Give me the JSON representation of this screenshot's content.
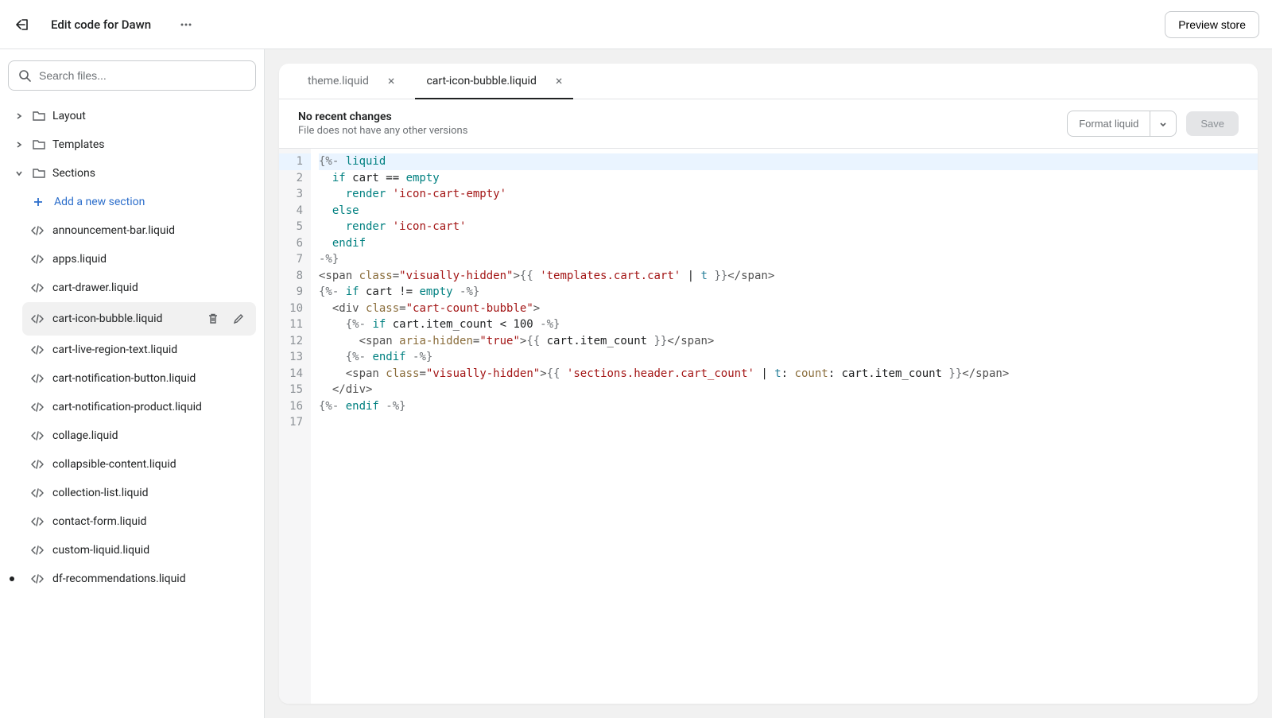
{
  "header": {
    "title": "Edit code for Dawn",
    "preview_label": "Preview store"
  },
  "sidebar": {
    "search_placeholder": "Search files...",
    "folders": [
      {
        "name": "Layout",
        "expanded": false
      },
      {
        "name": "Templates",
        "expanded": false
      },
      {
        "name": "Sections",
        "expanded": true
      }
    ],
    "add_section_label": "Add a new section",
    "files": [
      {
        "name": "announcement-bar.liquid",
        "active": false,
        "dot": false
      },
      {
        "name": "apps.liquid",
        "active": false,
        "dot": false
      },
      {
        "name": "cart-drawer.liquid",
        "active": false,
        "dot": false
      },
      {
        "name": "cart-icon-bubble.liquid",
        "active": true,
        "dot": false
      },
      {
        "name": "cart-live-region-text.liquid",
        "active": false,
        "dot": false
      },
      {
        "name": "cart-notification-button.liquid",
        "active": false,
        "dot": false
      },
      {
        "name": "cart-notification-product.liquid",
        "active": false,
        "dot": false
      },
      {
        "name": "collage.liquid",
        "active": false,
        "dot": false
      },
      {
        "name": "collapsible-content.liquid",
        "active": false,
        "dot": false
      },
      {
        "name": "collection-list.liquid",
        "active": false,
        "dot": false
      },
      {
        "name": "contact-form.liquid",
        "active": false,
        "dot": false
      },
      {
        "name": "custom-liquid.liquid",
        "active": false,
        "dot": false
      },
      {
        "name": "df-recommendations.liquid",
        "active": false,
        "dot": true
      }
    ]
  },
  "tabs": [
    {
      "label": "theme.liquid",
      "active": false
    },
    {
      "label": "cart-icon-bubble.liquid",
      "active": true
    }
  ],
  "toolbar": {
    "title": "No recent changes",
    "subtitle": "File does not have any other versions",
    "format_label": "Format liquid",
    "save_label": "Save"
  },
  "editor": {
    "line_count": 17,
    "highlighted_line": 1,
    "raw_lines": [
      "{%- liquid",
      "  if cart == empty",
      "    render 'icon-cart-empty'",
      "  else",
      "    render 'icon-cart'",
      "  endif",
      "-%}",
      "<span class=\"visually-hidden\">{{ 'templates.cart.cart' | t }}</span>",
      "{%- if cart != empty -%}",
      "  <div class=\"cart-count-bubble\">",
      "    {%- if cart.item_count < 100 -%}",
      "      <span aria-hidden=\"true\">{{ cart.item_count }}</span>",
      "    {%- endif -%}",
      "    <span class=\"visually-hidden\">{{ 'sections.header.cart_count' | t: count: cart.item_count }}</span>",
      "  </div>",
      "{%- endif -%}",
      ""
    ],
    "tokens": [
      [
        [
          "{%- ",
          "delim"
        ],
        [
          "liquid",
          "kw"
        ]
      ],
      [
        [
          "  ",
          ""
        ],
        [
          "if",
          "kw"
        ],
        [
          " cart == ",
          ""
        ],
        [
          "empty",
          "kw"
        ]
      ],
      [
        [
          "    ",
          ""
        ],
        [
          "render",
          "kw"
        ],
        [
          " ",
          ""
        ],
        [
          "'icon-cart-empty'",
          "str"
        ]
      ],
      [
        [
          "  ",
          ""
        ],
        [
          "else",
          "kw"
        ]
      ],
      [
        [
          "    ",
          ""
        ],
        [
          "render",
          "kw"
        ],
        [
          " ",
          ""
        ],
        [
          "'icon-cart'",
          "str"
        ]
      ],
      [
        [
          "  ",
          ""
        ],
        [
          "endif",
          "kw"
        ]
      ],
      [
        [
          "-%}",
          "delim"
        ]
      ],
      [
        [
          "<span ",
          "tag"
        ],
        [
          "class",
          "attr"
        ],
        [
          "=",
          "tag"
        ],
        [
          "\"visually-hidden\"",
          "str"
        ],
        [
          ">",
          "tag"
        ],
        [
          "{{ ",
          "delim"
        ],
        [
          "'templates.cart.cart'",
          "str"
        ],
        [
          " | ",
          ""
        ],
        [
          "t",
          "filter"
        ],
        [
          " }}",
          "delim"
        ],
        [
          "</span>",
          "tag"
        ]
      ],
      [
        [
          "{%- ",
          "delim"
        ],
        [
          "if",
          "kw"
        ],
        [
          " cart != ",
          ""
        ],
        [
          "empty",
          "kw"
        ],
        [
          " -%}",
          "delim"
        ]
      ],
      [
        [
          "  ",
          ""
        ],
        [
          "<div ",
          "tag"
        ],
        [
          "class",
          "attr"
        ],
        [
          "=",
          "tag"
        ],
        [
          "\"cart-count-bubble\"",
          "str"
        ],
        [
          ">",
          "tag"
        ]
      ],
      [
        [
          "    ",
          ""
        ],
        [
          "{%- ",
          "delim"
        ],
        [
          "if",
          "kw"
        ],
        [
          " cart.item_count < 100 ",
          ""
        ],
        [
          "-%}",
          "delim"
        ]
      ],
      [
        [
          "      ",
          ""
        ],
        [
          "<span ",
          "tag"
        ],
        [
          "aria-hidden",
          "attr"
        ],
        [
          "=",
          "tag"
        ],
        [
          "\"true\"",
          "str"
        ],
        [
          ">",
          "tag"
        ],
        [
          "{{ ",
          "delim"
        ],
        [
          "cart.item_count",
          ""
        ],
        [
          " }}",
          "delim"
        ],
        [
          "</span>",
          "tag"
        ]
      ],
      [
        [
          "    ",
          ""
        ],
        [
          "{%- ",
          "delim"
        ],
        [
          "endif",
          "kw"
        ],
        [
          " -%}",
          "delim"
        ]
      ],
      [
        [
          "    ",
          ""
        ],
        [
          "<span ",
          "tag"
        ],
        [
          "class",
          "attr"
        ],
        [
          "=",
          "tag"
        ],
        [
          "\"visually-hidden\"",
          "str"
        ],
        [
          ">",
          "tag"
        ],
        [
          "{{ ",
          "delim"
        ],
        [
          "'sections.header.cart_count'",
          "str"
        ],
        [
          " | ",
          ""
        ],
        [
          "t",
          "filter"
        ],
        [
          ": ",
          ""
        ],
        [
          "count",
          "attr"
        ],
        [
          ": cart.item_count ",
          ""
        ],
        [
          "}}",
          "delim"
        ],
        [
          "</span>",
          "tag"
        ]
      ],
      [
        [
          "  ",
          ""
        ],
        [
          "</div>",
          "tag"
        ]
      ],
      [
        [
          "{%- ",
          "delim"
        ],
        [
          "endif",
          "kw"
        ],
        [
          " -%}",
          "delim"
        ]
      ],
      []
    ]
  }
}
